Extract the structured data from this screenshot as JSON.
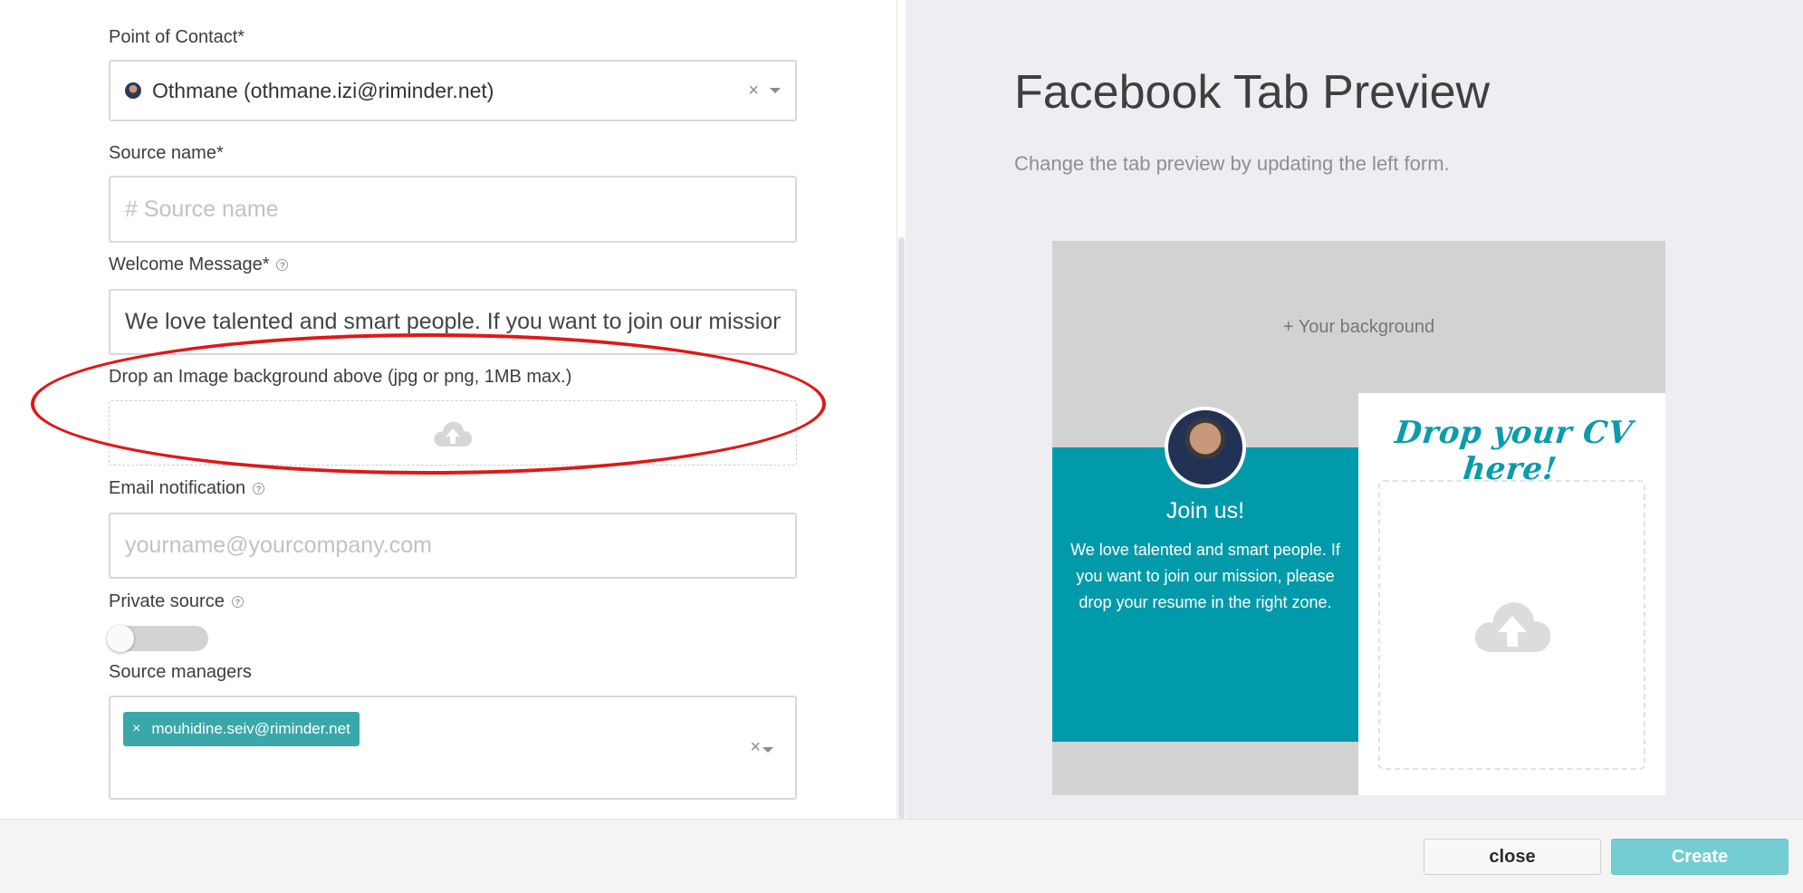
{
  "form": {
    "contact": {
      "label": "Point of Contact*",
      "value": "Othmane (othmane.izi@riminder.net)",
      "clear": "×"
    },
    "source_name": {
      "label": "Source name*",
      "placeholder": "# Source name",
      "value": ""
    },
    "welcome": {
      "label": "Welcome Message*",
      "help": "?",
      "value": "We love talented and smart people. If you want to join our mission, please drop your resume in the right zone."
    },
    "image_drop": {
      "label": "Drop an Image background above (jpg or png, 1MB max.)",
      "icon": "cloud-upload-icon"
    },
    "email": {
      "label": "Email notification",
      "help": "?",
      "placeholder": "yourname@yourcompany.com"
    },
    "private": {
      "label": "Private source",
      "help": "?",
      "enabled": false
    },
    "managers": {
      "label": "Source managers",
      "tags": [
        {
          "remove": "×",
          "text": "mouhidine.seiv@riminder.net"
        }
      ],
      "clear": "×"
    }
  },
  "preview": {
    "title": "Facebook Tab Preview",
    "subtitle": "Change the tab preview by updating the left form.",
    "background_placeholder": "+ Your background",
    "join_title": "Join us!",
    "join_text": "We love talented and smart people. If you want to join our mission, please drop your resume in the right zone.",
    "drop_cv": "Drop your CV here!"
  },
  "footer": {
    "close_label": "close",
    "create_label": "Create"
  },
  "colors": {
    "teal": "#019aaa",
    "tag": "#3aa7aa",
    "create_button": "#74cdd2",
    "annotation": "#e01818"
  }
}
